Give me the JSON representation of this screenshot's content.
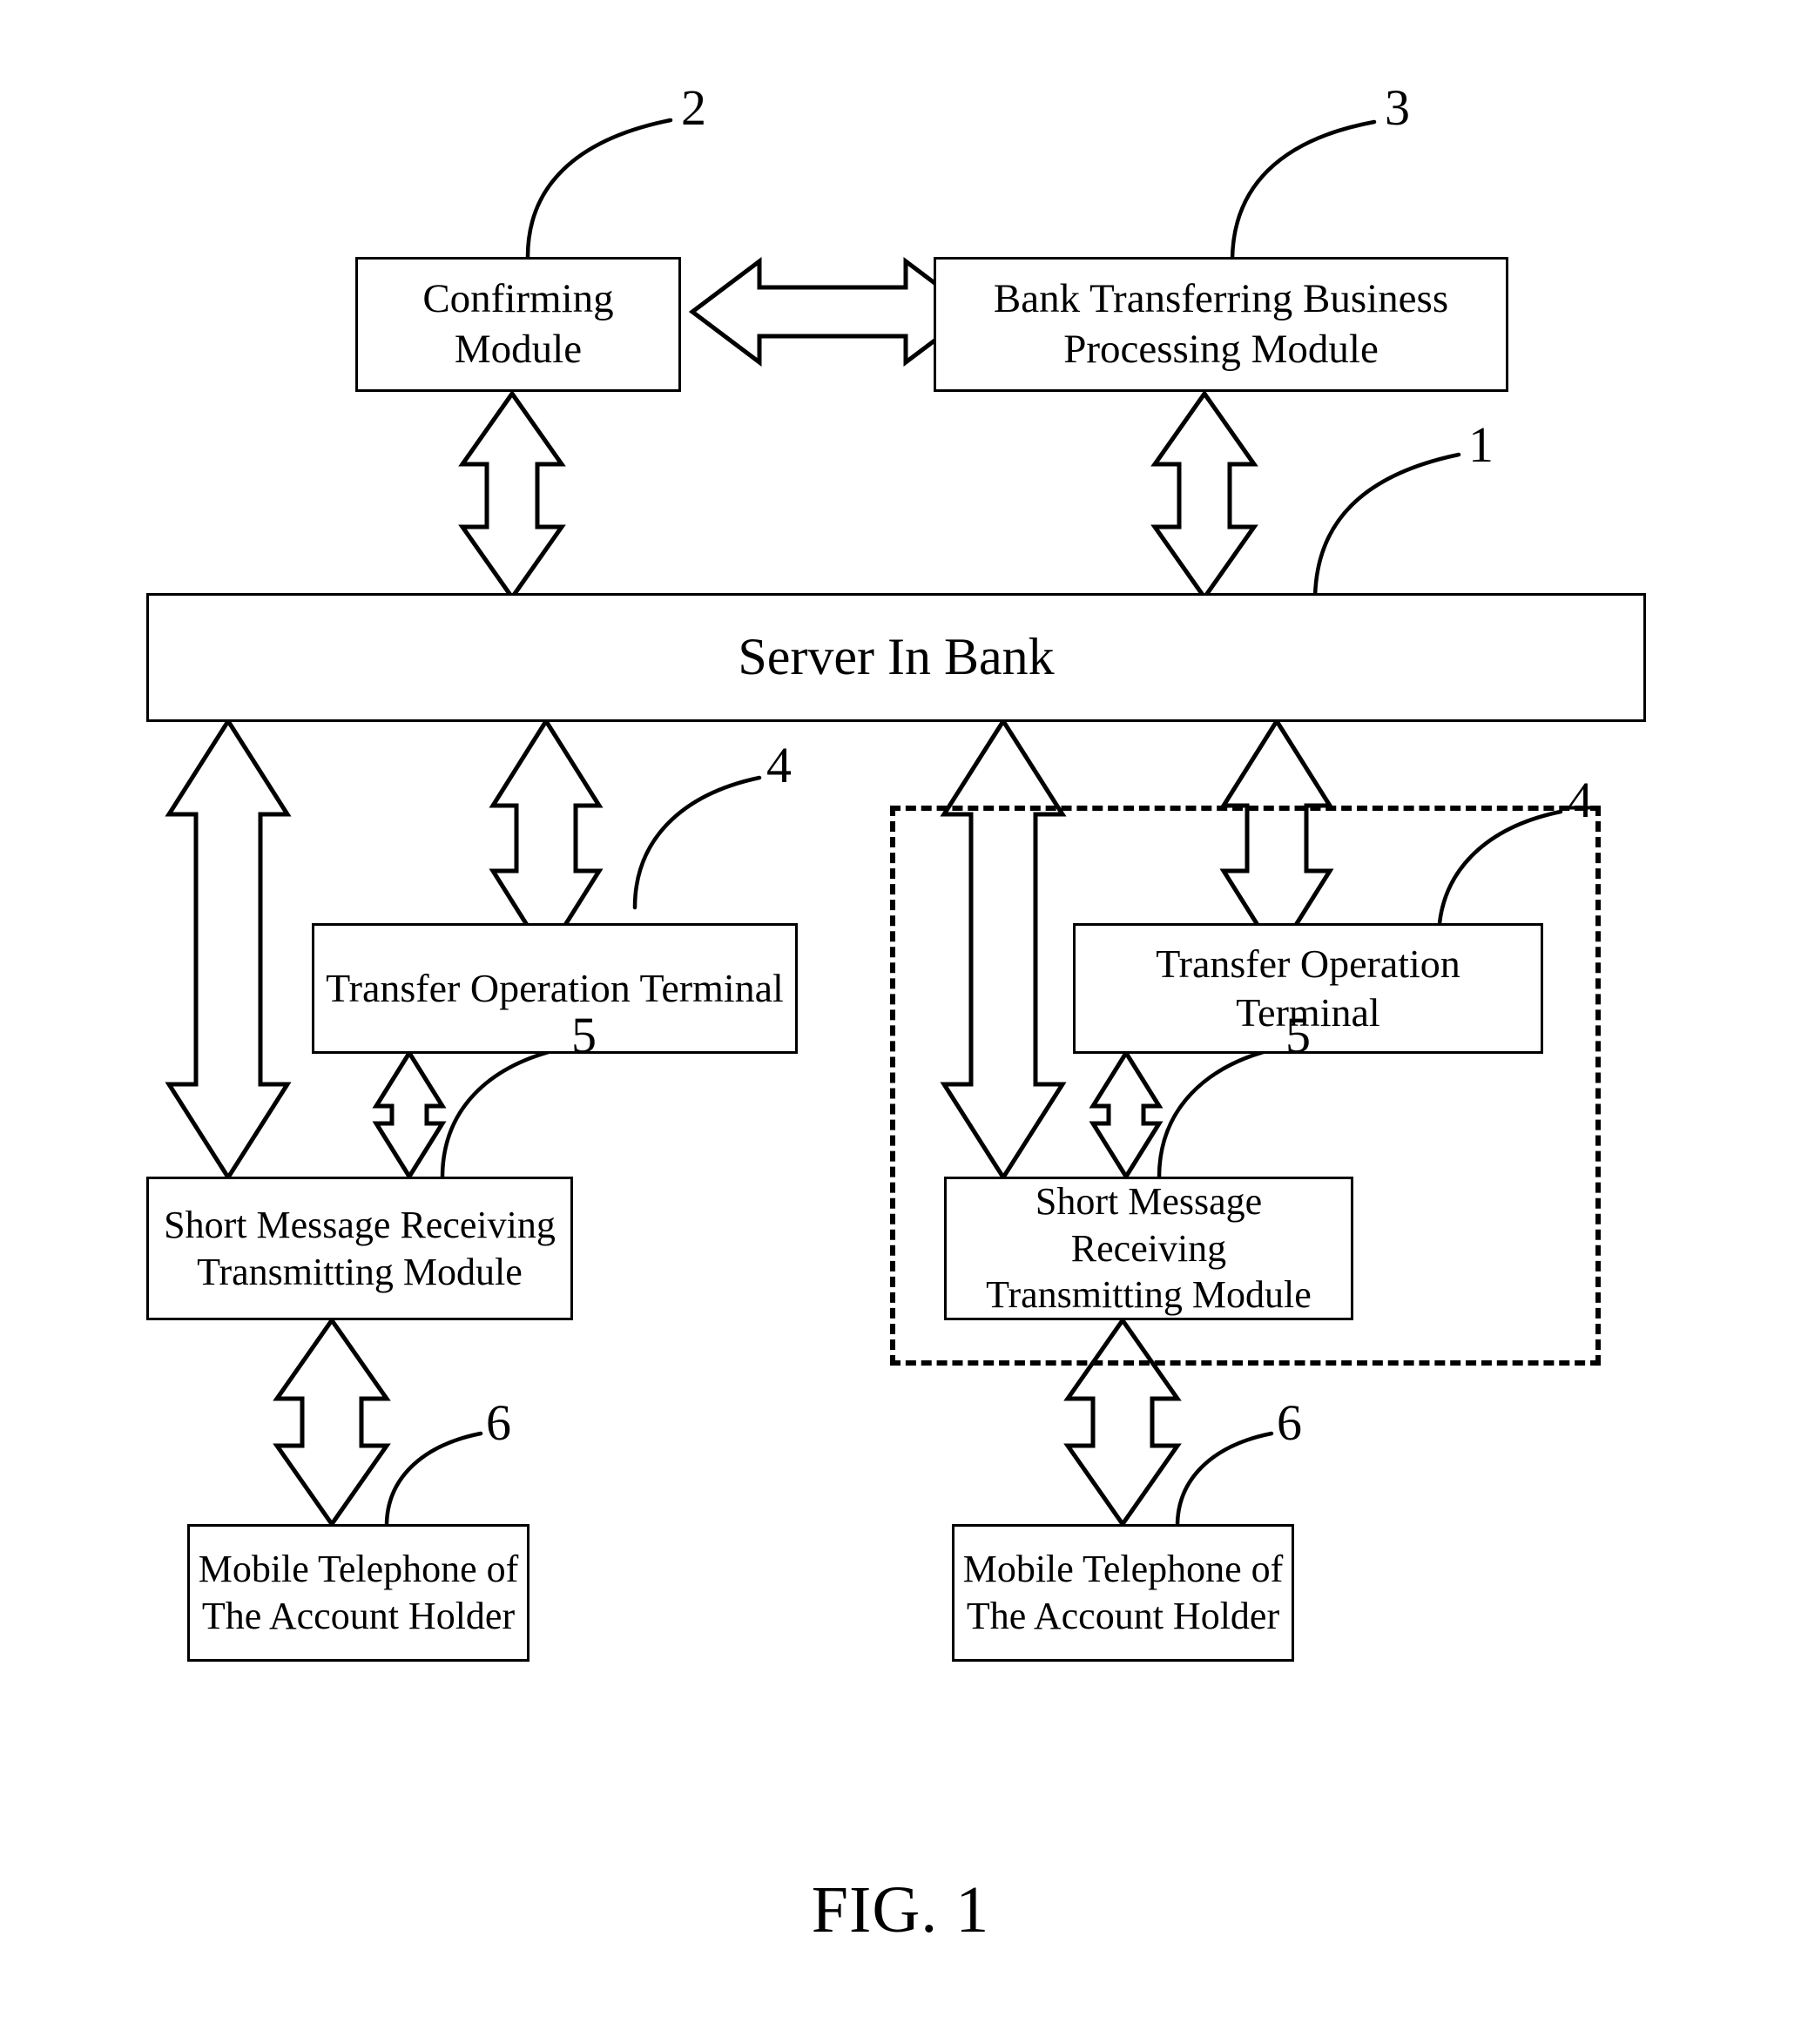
{
  "figure": {
    "caption": "FIG. 1",
    "nodes": {
      "confirming_module": "Confirming Module",
      "bank_processing_module": "Bank Transferring Business\nProcessing Module",
      "bank_processing_module_line1": "Bank Transferring Business",
      "bank_processing_module_line2": "Processing Module",
      "server": "Server In Bank",
      "terminal_left": "Transfer Operation Terminal",
      "terminal_right": "Transfer Operation Terminal",
      "sms_left_line1": "Short Message Receiving",
      "sms_left_line2": "Transmitting Module",
      "sms_right_line1": "Short Message Receiving",
      "sms_right_line2": "Transmitting Module",
      "phone_left_line1": "Mobile Telephone of",
      "phone_left_line2": "The Account Holder",
      "phone_right_line1": "Mobile Telephone of",
      "phone_right_line2": "The Account Holder"
    },
    "reference_numerals": {
      "server": "1",
      "confirming_module": "2",
      "bank_processing_module": "3",
      "terminal_left": "4",
      "terminal_right": "4",
      "sms_left": "5",
      "sms_right": "5",
      "phone_left": "6",
      "phone_right": "6"
    },
    "colors": {
      "line": "#000000",
      "background": "#ffffff"
    }
  },
  "chart_data": {
    "type": "diagram",
    "title": "FIG. 1",
    "nodes": [
      {
        "id": "1",
        "label": "Server In Bank"
      },
      {
        "id": "2",
        "label": "Confirming Module"
      },
      {
        "id": "3",
        "label": "Bank Transferring Business Processing Module"
      },
      {
        "id": "4",
        "label": "Transfer Operation Terminal"
      },
      {
        "id": "5",
        "label": "Short Message Receiving Transmitting Module"
      },
      {
        "id": "6",
        "label": "Mobile Telephone of The Account Holder"
      }
    ],
    "edges": [
      {
        "from": "2",
        "to": "3",
        "style": "double-arrow-horizontal"
      },
      {
        "from": "2",
        "to": "1",
        "style": "double-arrow-vertical"
      },
      {
        "from": "3",
        "to": "1",
        "style": "double-arrow-vertical"
      },
      {
        "from": "1",
        "to": "5",
        "style": "double-arrow-vertical"
      },
      {
        "from": "1",
        "to": "4",
        "style": "double-arrow-vertical"
      },
      {
        "from": "4",
        "to": "5",
        "style": "double-arrow-vertical"
      },
      {
        "from": "5",
        "to": "6",
        "style": "double-arrow-vertical"
      }
    ],
    "groups": [
      {
        "style": "dashed",
        "contains": [
          "4",
          "5"
        ],
        "side": "right"
      }
    ]
  }
}
